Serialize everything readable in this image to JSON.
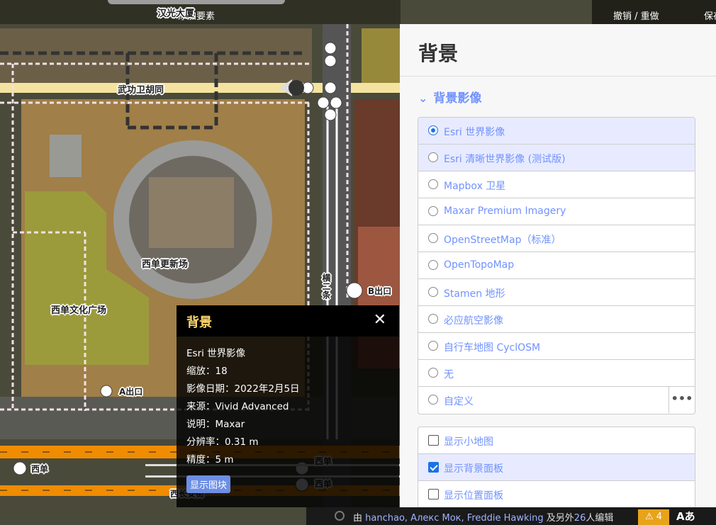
{
  "toolbar": {
    "add_feature": "添加要素",
    "undo_redo": "撤销 / 重做",
    "save": "保存"
  },
  "map_labels": {
    "street_1": "汉光大厦",
    "street_2": "武功卫胡同",
    "place_1": "西单更新场",
    "place_2": "西单文化广场",
    "exit_a": "A出口",
    "exit_b": "B出口",
    "station_1": "西单",
    "station_2": "西单",
    "station_3": "西单",
    "road_bottom": "西长安街",
    "road_vertical": "横二条"
  },
  "info_panel": {
    "title": "背景",
    "close_label": "✕",
    "source_name": "Esri 世界影像",
    "zoom": "缩放：18",
    "date": "影像日期：2022年2月5日",
    "vendor": "来源：Vivid Advanced",
    "desc": "说明：Maxar",
    "resolution": "分辨率：0.31 m",
    "accuracy": "精度：5 m",
    "show_tiles": "显示图块"
  },
  "sidebar": {
    "title": "背景",
    "section": "背景影像",
    "imagery": [
      {
        "label": "Esri 世界影像",
        "selected": true
      },
      {
        "label": "Esri 清晰世界影像 (测试版)",
        "selected": false
      },
      {
        "label": "Mapbox 卫星",
        "selected": false
      },
      {
        "label": "Maxar Premium Imagery",
        "selected": false
      },
      {
        "label": "OpenStreetMap（标准）",
        "selected": false
      },
      {
        "label": "OpenTopoMap",
        "selected": false
      },
      {
        "label": "Stamen 地形",
        "selected": false
      },
      {
        "label": "必应航空影像",
        "selected": false
      },
      {
        "label": "自行车地图 CyclOSM",
        "selected": false
      },
      {
        "label": "无",
        "selected": false
      },
      {
        "label": "自定义",
        "selected": false
      }
    ],
    "options": [
      {
        "label": "显示小地图",
        "checked": false
      },
      {
        "label": "显示背景面板",
        "checked": true
      },
      {
        "label": "显示位置面板",
        "checked": false
      }
    ],
    "custom_more": "•••"
  },
  "footer": {
    "prefix": "由",
    "users": "hanchao, Алекс Мок, Freddie Hawking",
    "middle": "及另外",
    "count": "26",
    "suffix": "人编辑",
    "warnings": "⚠ 4",
    "a11y": "Aあ"
  }
}
